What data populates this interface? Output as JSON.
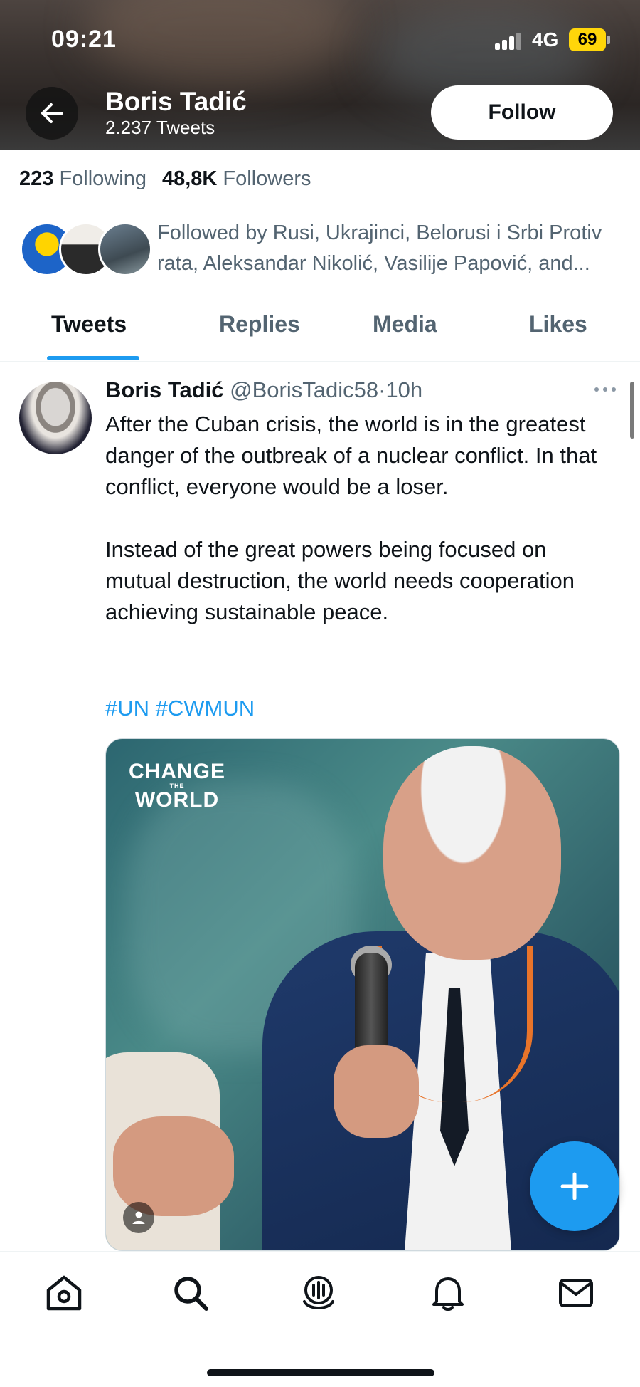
{
  "status_bar": {
    "time": "09:21",
    "network": "4G",
    "battery": "69"
  },
  "header": {
    "name": "Boris Tadić",
    "tweets_count": "2.237 Tweets",
    "follow_label": "Follow"
  },
  "stats": {
    "following_count": "223",
    "following_label": "Following",
    "followers_count": "48,8K",
    "followers_label": "Followers"
  },
  "followed_by": {
    "text": "Followed by Rusi, Ukrajinci, Belorusi i Srbi Protiv rata, Aleksandar Nikolić, Vasilije Papović, and..."
  },
  "tabs": [
    {
      "label": "Tweets",
      "active": true
    },
    {
      "label": "Replies",
      "active": false
    },
    {
      "label": "Media",
      "active": false
    },
    {
      "label": "Likes",
      "active": false
    }
  ],
  "tweet": {
    "author_name": "Boris Tadić",
    "handle": "@BorisTadic58",
    "separator": "·",
    "time": "10h",
    "paragraph1": "After the Cuban crisis, the world is in the greatest danger of the outbreak of a nuclear conflict. In that conflict, everyone would be a loser.",
    "paragraph2": "Instead of the great powers being focused on mutual destruction, the world needs cooperation achieving sustainable peace.",
    "hashtags": "#UN #CWMUN",
    "media": {
      "logo_line1": "CHANGE",
      "logo_small": "THE",
      "logo_line2": "WORLD"
    }
  },
  "bottom_nav": [
    "home-icon",
    "search-icon",
    "spaces-icon",
    "notifications-icon",
    "messages-icon"
  ],
  "colors": {
    "accent": "#1d9bf0",
    "text": "#0f1419",
    "secondary": "#536471"
  }
}
